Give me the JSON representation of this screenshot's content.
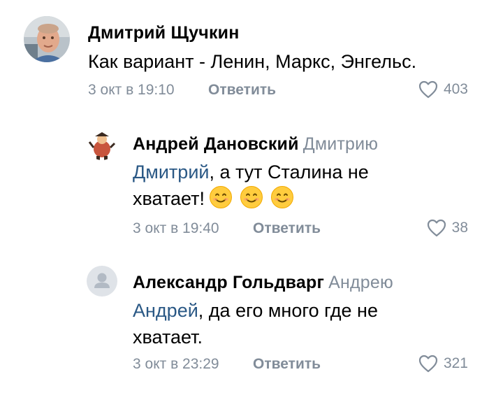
{
  "comments": [
    {
      "author": "Дмитрий Щучкин",
      "reply_to": "",
      "mention": "",
      "text": "Как вариант - Ленин, Маркс, Энгельс.",
      "date": "3 окт в 19:10",
      "reply_label": "Ответить",
      "likes": "403",
      "avatar_icon": "user-photo-icon"
    },
    {
      "author": "Андрей Дановский",
      "reply_to": "Дмитрию",
      "mention": "Дмитрий",
      "text_line1": ", а тут Сталина не",
      "text_line2": "хватает!",
      "emojis": [
        "smiling-face-emoji",
        "smiling-face-emoji",
        "smiling-face-emoji"
      ],
      "date": "3 окт в 19:40",
      "reply_label": "Ответить",
      "likes": "38",
      "avatar_icon": "cartoon-character-icon"
    },
    {
      "author": "Александр Гольдварг",
      "reply_to": "Андрею",
      "mention": "Андрей",
      "text_line1": ", да его много где не",
      "text_line2": "хватает.",
      "date": "3 окт в 23:29",
      "reply_label": "Ответить",
      "likes": "321",
      "avatar_icon": "default-user-icon"
    }
  ],
  "colors": {
    "secondary_text": "#818c99",
    "mention": "#2a5885",
    "placeholder_avatar_bg": "#dfe3e8"
  }
}
